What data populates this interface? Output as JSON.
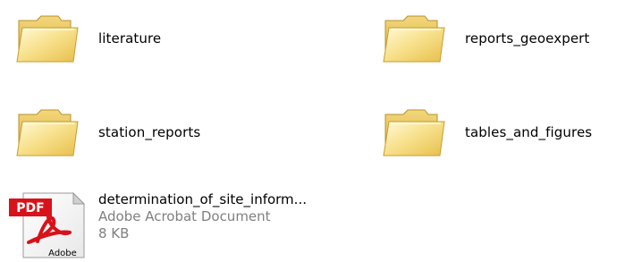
{
  "items": [
    {
      "name": "literature",
      "icon": "folder-icon"
    },
    {
      "name": "reports_geoexpert",
      "icon": "folder-icon"
    },
    {
      "name": "station_reports",
      "icon": "folder-icon"
    },
    {
      "name": "tables_and_figures",
      "icon": "folder-icon"
    }
  ],
  "file": {
    "name": "determination_of_site_inform...",
    "type": "Adobe Acrobat Document",
    "size": "8 KB",
    "icon": "pdf-file-icon",
    "icon_badge": "PDF",
    "icon_brand": "Adobe"
  },
  "colors": {
    "folder_light": "#fff6c2",
    "folder_mid": "#f6d66b",
    "folder_dark": "#c9a235",
    "pdf_red": "#d8121a",
    "meta_gray": "#808080"
  }
}
